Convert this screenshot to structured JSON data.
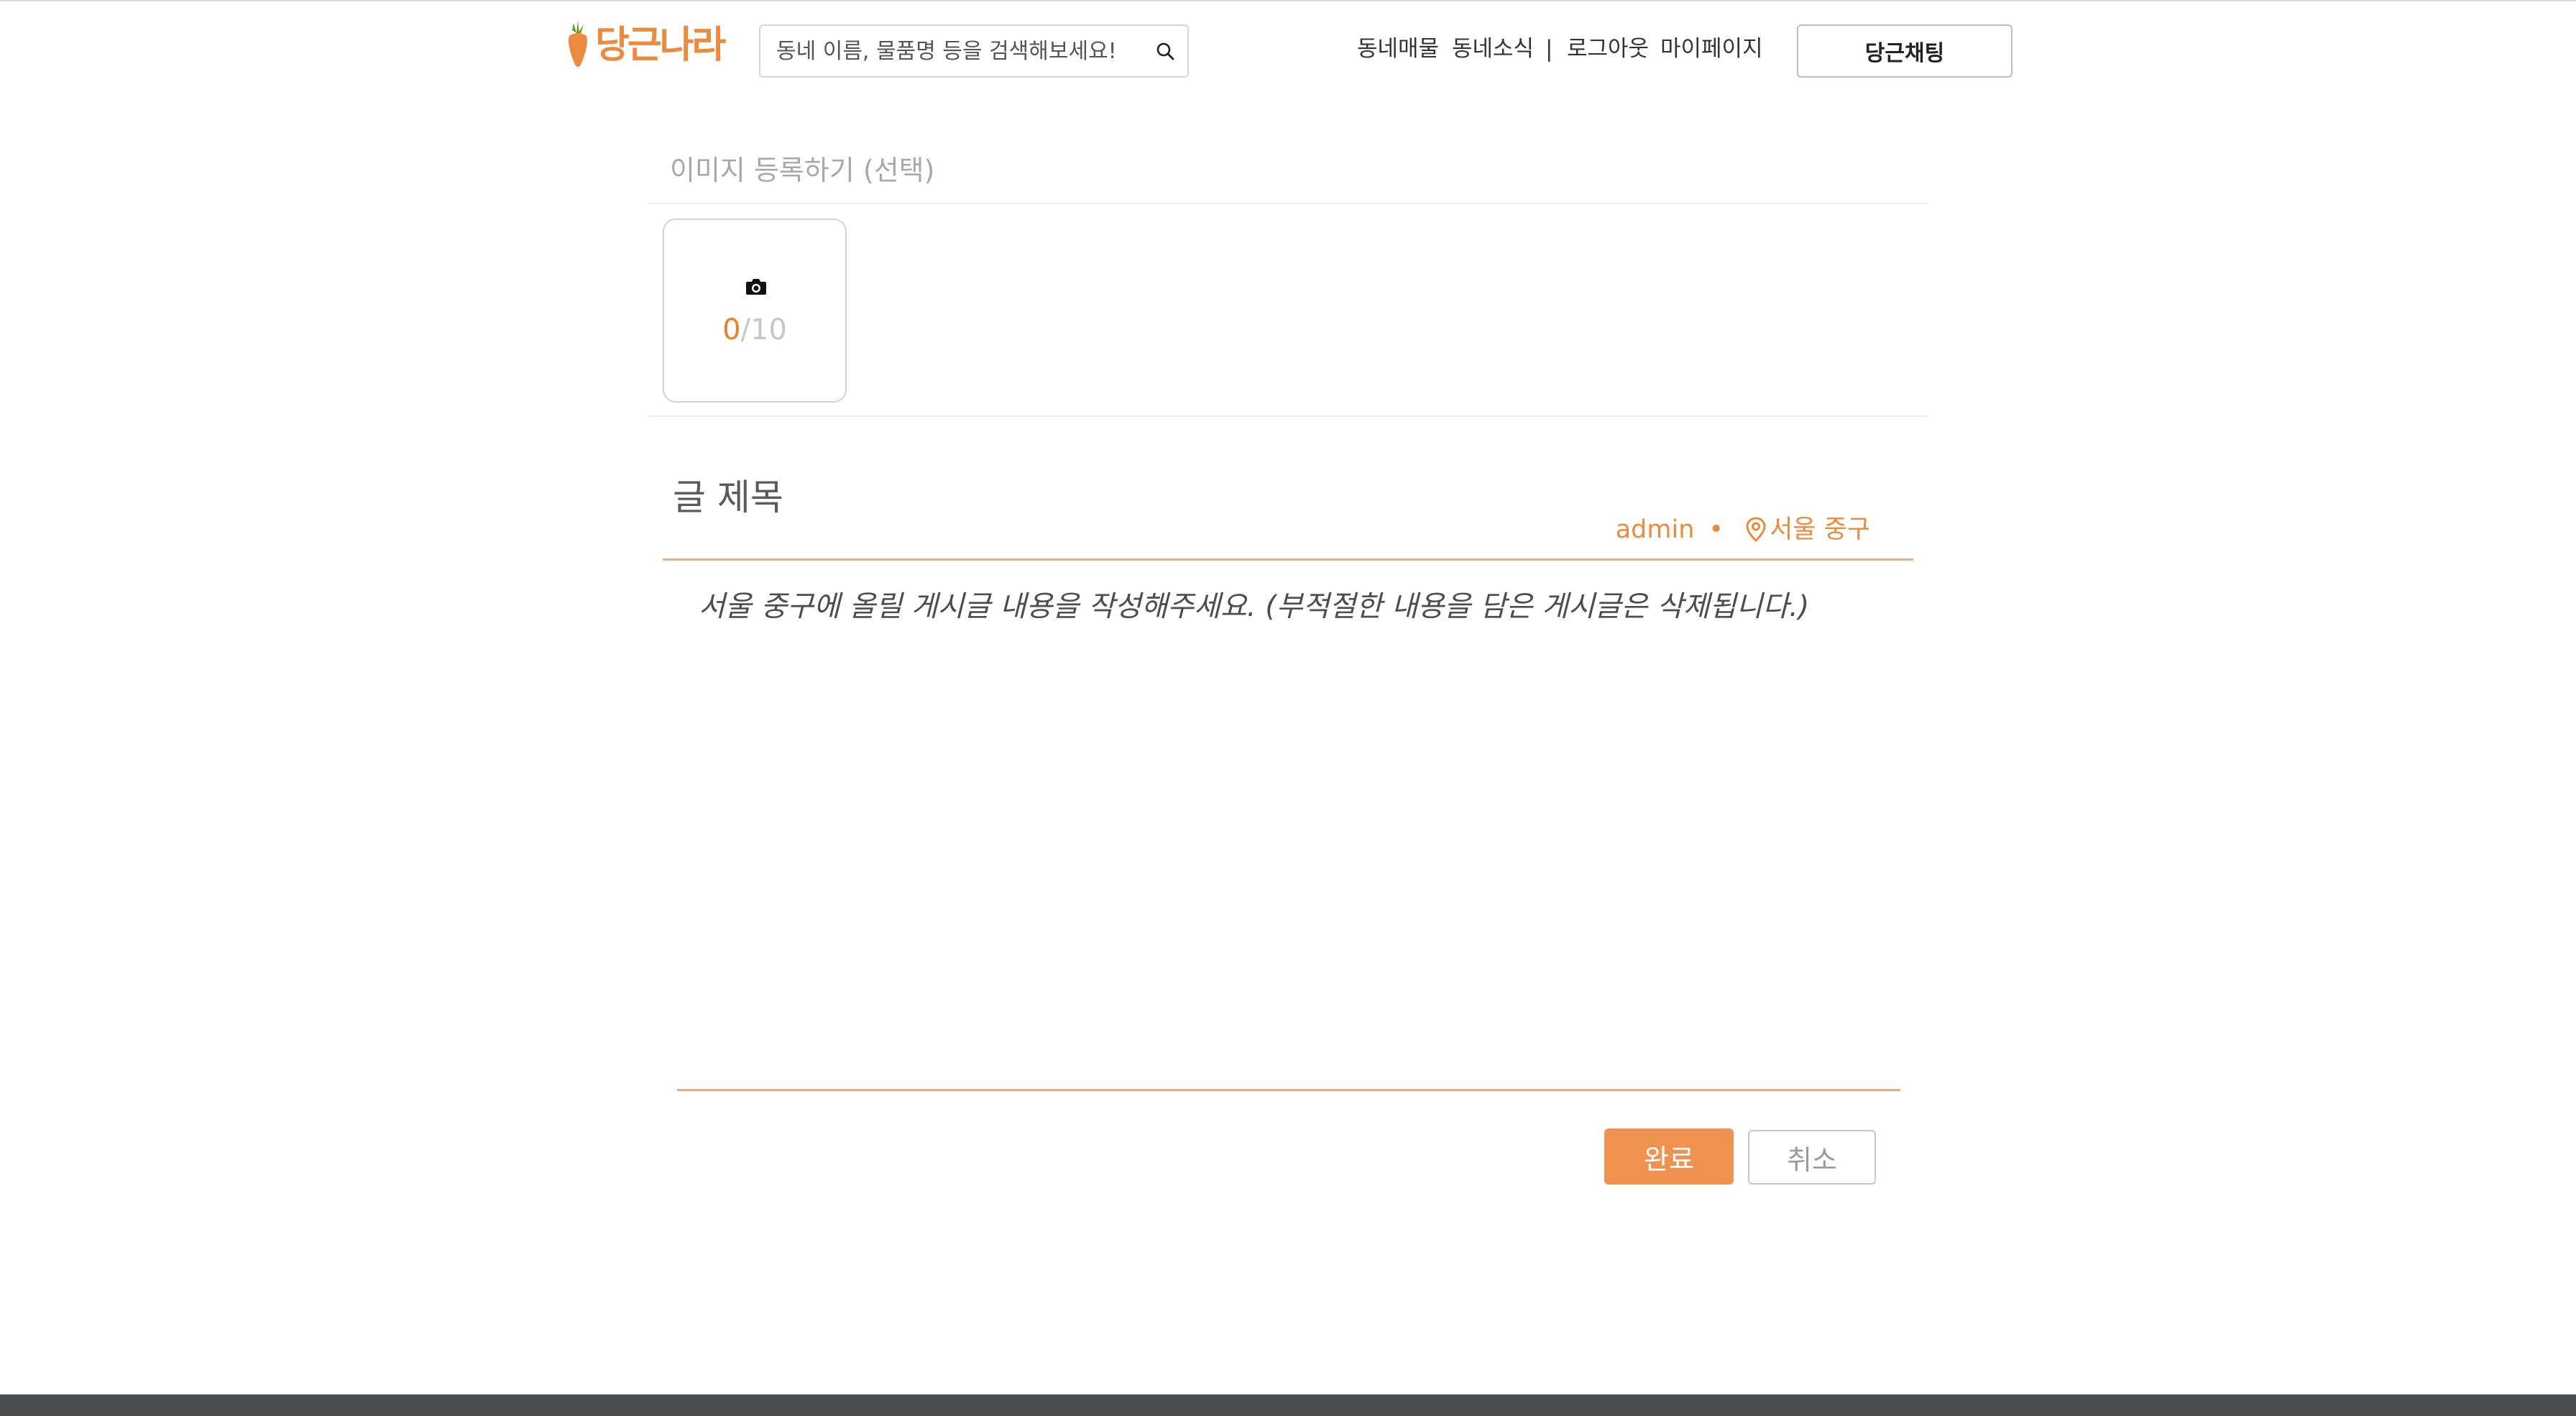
{
  "header": {
    "logo_text": "당근나라",
    "search": {
      "placeholder": "동네 이름, 물품명 등을 검색해보세요!",
      "value": ""
    },
    "nav": {
      "neighborhood_listings": "동네매물",
      "neighborhood_news": "동네소식",
      "separator": "|",
      "logout": "로그아웃",
      "mypage": "마이페이지"
    },
    "chat_button": "당근채팅"
  },
  "image_upload": {
    "heading": "이미지 등록하기 (선택)",
    "count_current": "0",
    "count_max": "/10",
    "icon": "camera-icon"
  },
  "post": {
    "title_placeholder": "글 제목",
    "title_value": "",
    "author": "admin",
    "dot": "•",
    "location": "서울 중구",
    "content_placeholder": "서울 중구에 올릴 게시글 내용을 작성해주세요. (부적절한 내용을 담은 게시글은 삭제됩니다.)"
  },
  "actions": {
    "done": "완료",
    "cancel": "취소"
  },
  "colors": {
    "accent": "#ec8a3e",
    "button": "#f0924f",
    "footer": "#4a4c50"
  }
}
